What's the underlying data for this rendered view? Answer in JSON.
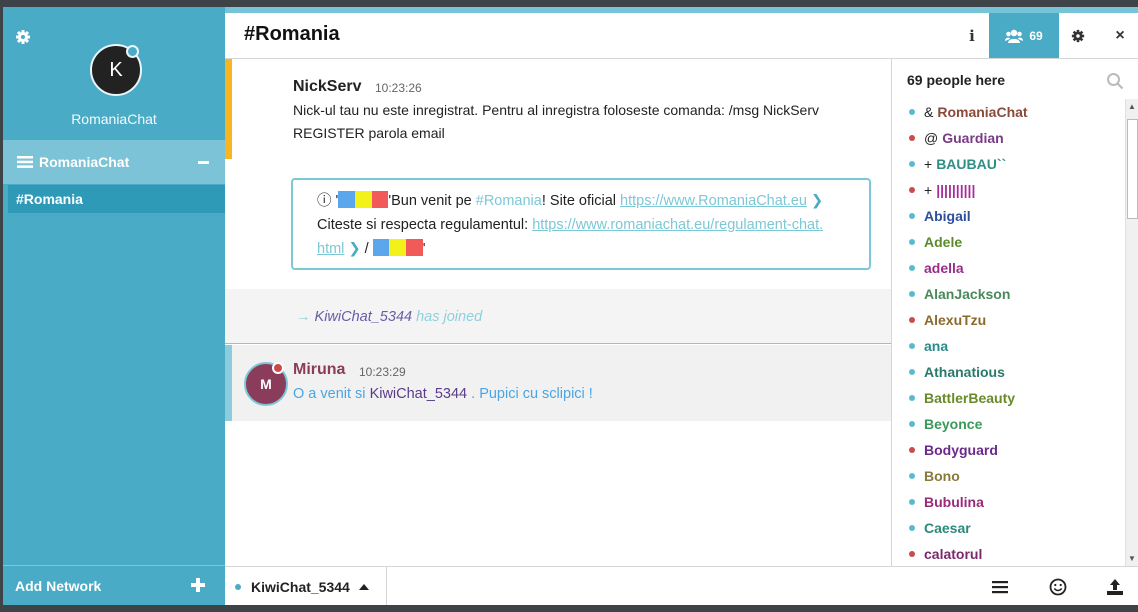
{
  "sidebar": {
    "avatar_letter": "K",
    "nick": "RomaniaChat",
    "network_name": "RomaniaChat",
    "channel_name": "#Romania",
    "add_network_label": "Add Network"
  },
  "header": {
    "title": "#Romania",
    "info_label": "i",
    "member_count": "69",
    "close_label": "×"
  },
  "messages": {
    "notice": {
      "nick": "NickServ",
      "time": "10:23:26",
      "text_line1": "Nick-ul tau nu este inregistrat. Pentru al inregistra foloseste comanda: /msg NickServ",
      "text_line2": "REGISTER parola email"
    },
    "topic": {
      "info_glyph": "ⓘ",
      "quote_open": "'",
      "quote_close": "'",
      "welcome_pre": "Bun venit pe ",
      "channel_link": "#Romania",
      "site_text": "! Site oficial ",
      "site_url": "https://www.RomaniaChat.eu",
      "rules_text": "Citeste si respecta regulamentul: ",
      "rules_url_line1": "https://www.romaniachat.eu/regulament-chat.",
      "rules_url_line2": "html",
      "separator": " / ",
      "chevron": "❯"
    },
    "join": {
      "arrow": "→",
      "nick": "KiwiChat_5344",
      "text": "has joined"
    },
    "chat": {
      "avatar_letter": "M",
      "nick": "Miruna",
      "time": "10:23:29",
      "text_pre": "O a venit si ",
      "mention": "KiwiChat_5344",
      "text_post": " . Pupici cu sclipici !"
    }
  },
  "members": {
    "header": "69 people here",
    "list": [
      {
        "mode": "&",
        "name": "RomaniaChat",
        "color": "#8a4a3a",
        "status": "#5bbad0"
      },
      {
        "mode": "@",
        "name": "Guardian",
        "color": "#7b3a86",
        "status": "#c94c4c"
      },
      {
        "mode": "+",
        "name": "BAUBAU``",
        "color": "#2f8f86",
        "status": "#5bbad0"
      },
      {
        "mode": "+",
        "name": "||||||||||",
        "color": "#a62d9a",
        "status": "#c94c4c"
      },
      {
        "mode": "",
        "name": "Abigail",
        "color": "#2d4f9a",
        "status": "#5bbad0"
      },
      {
        "mode": "",
        "name": "Adele",
        "color": "#5a8a2a",
        "status": "#5bbad0"
      },
      {
        "mode": "",
        "name": "adella",
        "color": "#9a2d8a",
        "status": "#5bbad0"
      },
      {
        "mode": "",
        "name": "AlanJackson",
        "color": "#4a8a5a",
        "status": "#5bbad0"
      },
      {
        "mode": "",
        "name": "AlexuTzu",
        "color": "#8a6a2a",
        "status": "#c94c4c"
      },
      {
        "mode": "",
        "name": "ana",
        "color": "#2a8a8a",
        "status": "#5bbad0"
      },
      {
        "mode": "",
        "name": "Athanatious",
        "color": "#2a7a6a",
        "status": "#5bbad0"
      },
      {
        "mode": "",
        "name": "BattlerBeauty",
        "color": "#6a8a2a",
        "status": "#5bbad0"
      },
      {
        "mode": "",
        "name": "Beyonce",
        "color": "#3a9a5a",
        "status": "#5bbad0"
      },
      {
        "mode": "",
        "name": "Bodyguard",
        "color": "#6a2a8a",
        "status": "#c94c4c"
      },
      {
        "mode": "",
        "name": "Bono",
        "color": "#8a7a3a",
        "status": "#5bbad0"
      },
      {
        "mode": "",
        "name": "Bubulina",
        "color": "#9a2a7a",
        "status": "#5bbad0"
      },
      {
        "mode": "",
        "name": "Caesar",
        "color": "#2a8a7a",
        "status": "#5bbad0"
      },
      {
        "mode": "",
        "name": "calatorul",
        "color": "#7a2a6a",
        "status": "#c94c4c"
      }
    ]
  },
  "bottombar": {
    "nick": "KiwiChat_5344"
  },
  "colors": {
    "sidebar_bg": "#4aabc6",
    "accent": "#4aabc6",
    "notice_border": "#f6b521",
    "flag_blue": "#5aa7ee",
    "flag_yellow": "#f2f21a",
    "flag_red": "#f25a5a"
  },
  "icons": [
    "gear-icon",
    "list-icon",
    "minus-icon",
    "plus-icon",
    "info-icon",
    "users-icon",
    "close-icon",
    "search-icon",
    "menu-icon",
    "emoji-icon",
    "upload-icon",
    "caret-up-icon"
  ]
}
